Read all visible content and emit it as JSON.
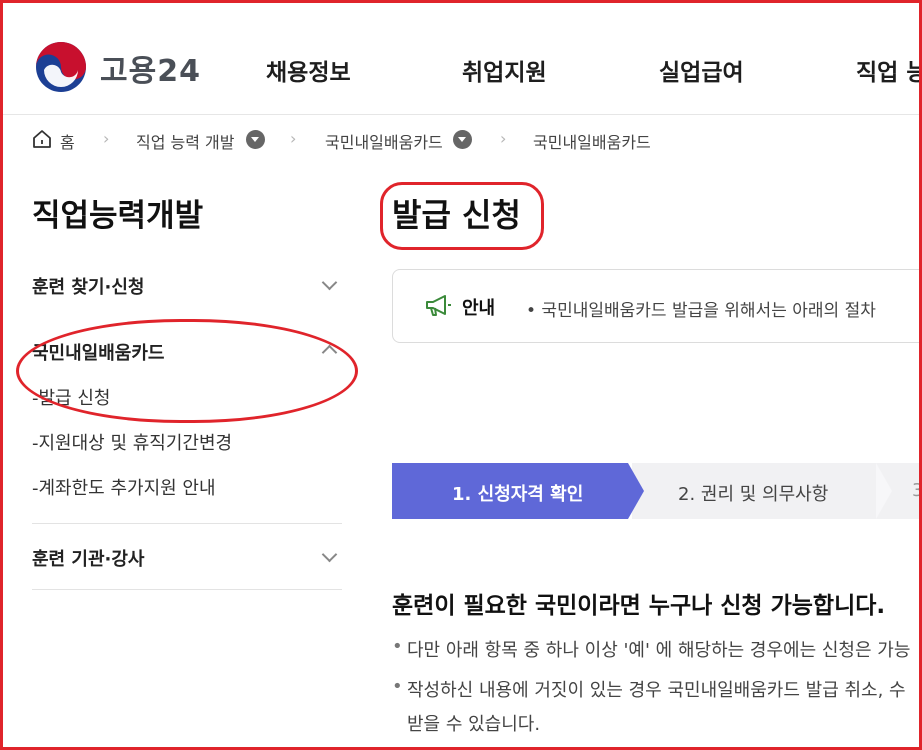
{
  "header": {
    "logo_text": "고용24",
    "nav": [
      "채용정보",
      "취업지원",
      "실업급여",
      "직업 능"
    ]
  },
  "breadcrumb": {
    "home": "홈",
    "level1": "직업 능력 개발",
    "level2": "국민내일배움카드",
    "level3": "국민내일배움카드"
  },
  "sidebar": {
    "title": "직업능력개발",
    "categories": [
      {
        "label": "훈련 찾기·신청",
        "expanded": false
      },
      {
        "label": "국민내일배움카드",
        "expanded": true,
        "items": [
          "-발급 신청",
          "-지원대상 및 휴직기간변경",
          "-계좌한도 추가지원 안내"
        ]
      },
      {
        "label": "훈련 기관·강사",
        "expanded": false
      }
    ]
  },
  "main": {
    "title": "발급 신청",
    "notice": {
      "label": "안내",
      "text": "• 국민내일배움카드 발급을 위해서는 아래의 절차"
    },
    "steps": [
      "1. 신청자격 확인",
      "2. 권리 및 의무사항",
      "3"
    ],
    "section_heading": "훈련이 필요한 국민이라면 누구나 신청 가능합니다.",
    "bullets": [
      "다만 아래 항목 중 하나 이상 '예' 에 해당하는 경우에는 신청은 가능",
      "작성하신 내용에 거짓이 있는 경우 국민내일배움카드 발급 취소, 수",
      "받을 수 있습니다."
    ],
    "bullet_marker": "•"
  },
  "colors": {
    "annotation": "#e0242b",
    "step_active": "#5f68d8",
    "logo_red": "#c8102e",
    "logo_blue": "#1c3f94"
  }
}
